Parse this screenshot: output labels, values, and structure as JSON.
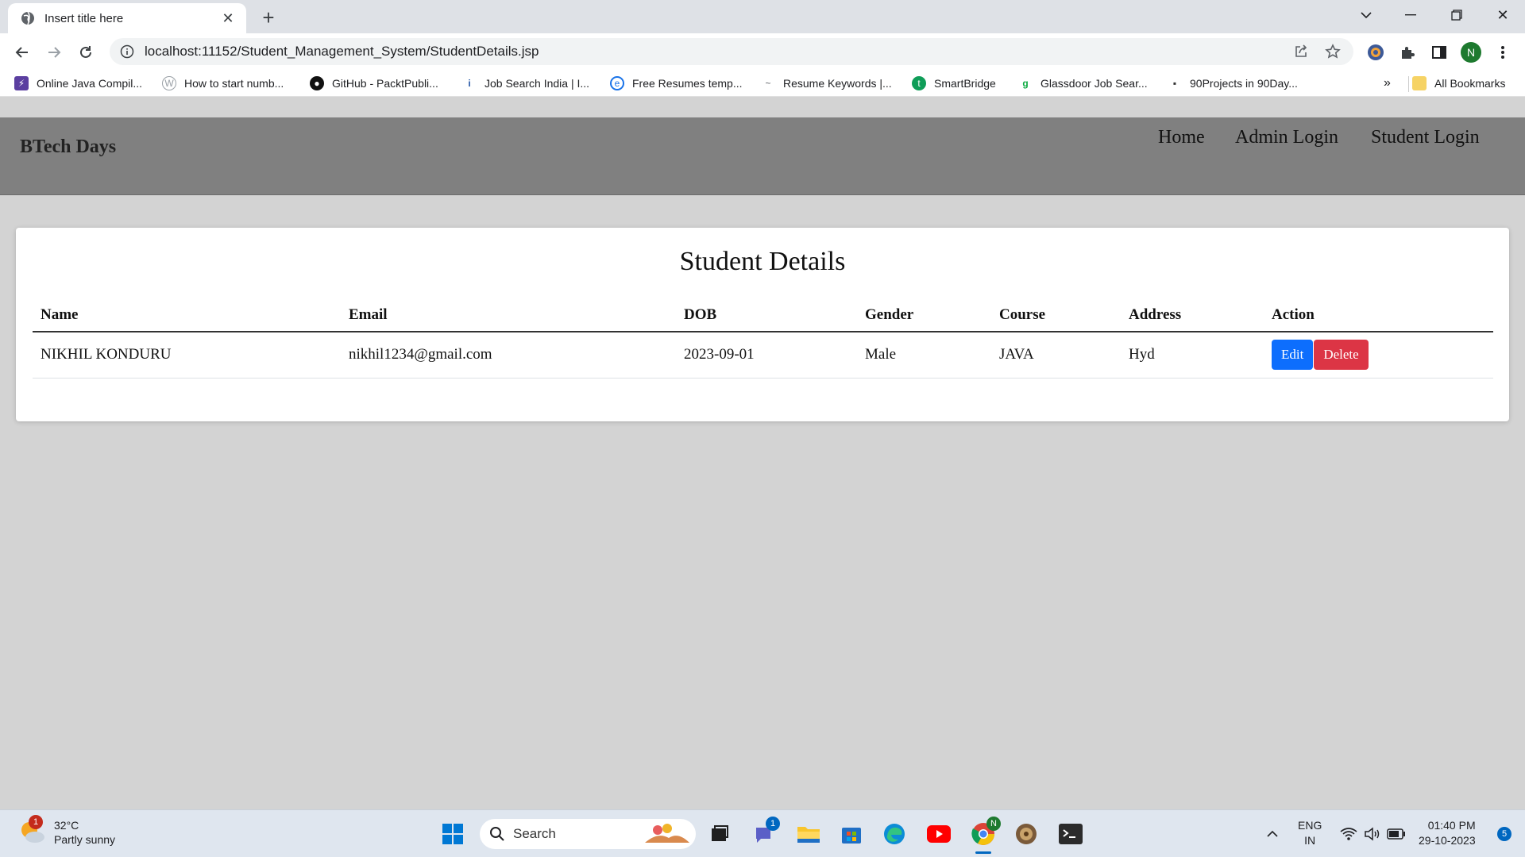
{
  "browser": {
    "tab_title": "Insert title here",
    "url": "localhost:11152/Student_Management_System/StudentDetails.jsp",
    "profile_initial": "N",
    "bookmarks": [
      {
        "label": "Online Java Compil...",
        "icon": "java-compiler-icon",
        "color": "#5b3fa0"
      },
      {
        "label": "How to start numb...",
        "icon": "blog-icon",
        "color": "#9aa0a6"
      },
      {
        "label": "GitHub - PacktPubli...",
        "icon": "github-icon",
        "color": "#111111"
      },
      {
        "label": "Job Search India | I...",
        "icon": "indeed-icon",
        "color": "#2557a7"
      },
      {
        "label": "Free Resumes temp...",
        "icon": "resume-icon",
        "color": "#1a73e8"
      },
      {
        "label": "Resume Keywords |...",
        "icon": "keywords-icon",
        "color": "#5f6368"
      },
      {
        "label": "SmartBridge",
        "icon": "smartbridge-icon",
        "color": "#0f9d58"
      },
      {
        "label": "Glassdoor Job Sear...",
        "icon": "glassdoor-icon",
        "color": "#0caa41"
      },
      {
        "label": "90Projects in 90Day...",
        "icon": "projects-icon",
        "color": "#333333"
      }
    ],
    "more_bookmarks": "»",
    "all_bookmarks": "All Bookmarks"
  },
  "page": {
    "brand": "BTech Days",
    "nav": [
      "Home",
      "Admin Login",
      "Student Login"
    ],
    "card_title": "Student Details",
    "table": {
      "headers": [
        "Name",
        "Email",
        "DOB",
        "Gender",
        "Course",
        "Address",
        "Action"
      ],
      "rows": [
        {
          "name": "NIKHIL KONDURU",
          "email": "nikhil1234@gmail.com",
          "dob": "2023-09-01",
          "gender": "Male",
          "course": "JAVA",
          "address": "Hyd"
        }
      ],
      "edit_label": "Edit",
      "delete_label": "Delete"
    },
    "colors": {
      "navbar": "#808080",
      "background": "#d3d3d3",
      "edit": "#0d6efd",
      "delete": "#dc3545"
    }
  },
  "taskbar": {
    "weather_temp": "32°C",
    "weather_desc": "Partly sunny",
    "weather_badge": "1",
    "search_label": "Search",
    "teams_badge": "1",
    "lang_top": "ENG",
    "lang_bottom": "IN",
    "time": "01:40 PM",
    "date": "29-10-2023",
    "notifications": "5"
  }
}
